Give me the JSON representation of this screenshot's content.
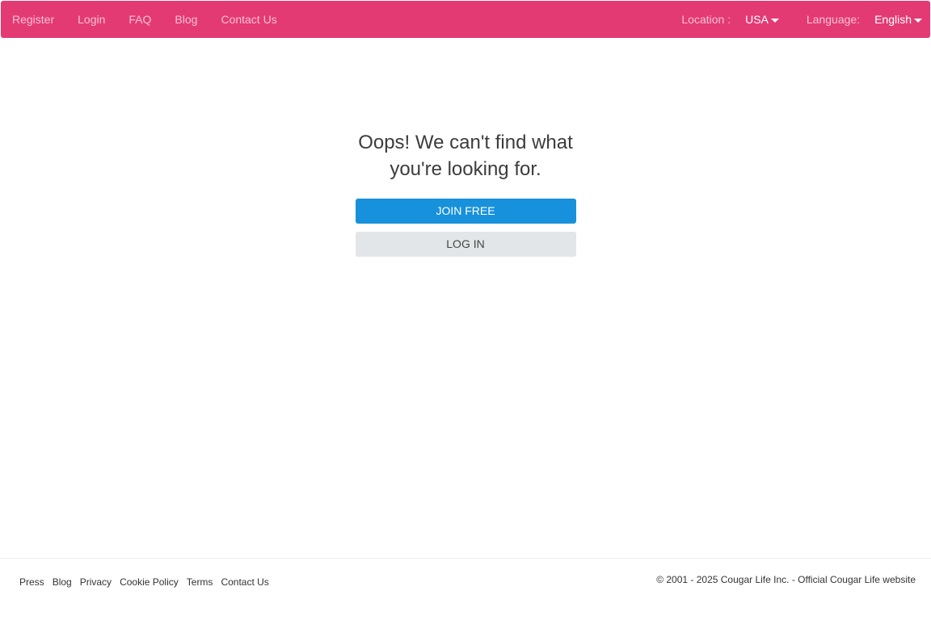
{
  "navbar": {
    "links": [
      "Register",
      "Login",
      "FAQ",
      "Blog",
      "Contact Us"
    ],
    "location_label": "Location :",
    "location_value": "USA",
    "language_label": "Language:",
    "language_value": "English"
  },
  "main": {
    "title": "Oops! We can't find what you're looking for.",
    "join_button": "JOIN FREE",
    "login_button": "LOG IN"
  },
  "footer": {
    "links": [
      "Press",
      "Blog",
      "Privacy",
      "Cookie Policy",
      "Terms",
      "Contact Us"
    ],
    "copyright": "© 2001 - 2025 Cougar Life Inc. - Official Cougar Life website"
  },
  "colors": {
    "navbar": "#e33a74",
    "join_button": "#1791db",
    "login_button": "#e2e6e9"
  },
  "icons": {
    "dropdown": "caret-down-icon"
  }
}
